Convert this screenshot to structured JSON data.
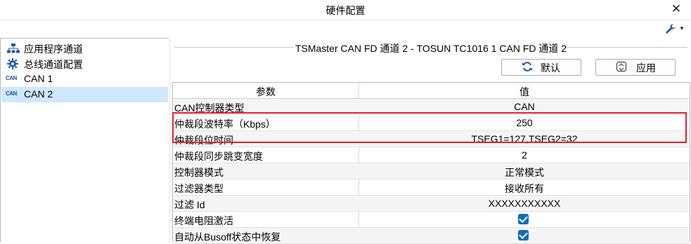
{
  "window": {
    "title": "硬件配置",
    "close_symbol": "✕"
  },
  "toolbar": {
    "tools_icon": "wrench-icon",
    "dropdown_icon": "caret-down-icon"
  },
  "sidebar": {
    "items": [
      {
        "label": "应用程序通道",
        "icon": "network-icon"
      },
      {
        "label": "总线通道配置",
        "icon": "gear-icon"
      },
      {
        "label": "CAN 1",
        "icon": "can-icon",
        "icon_text": "CAN"
      },
      {
        "label": "CAN 2",
        "icon": "can-icon",
        "icon_text": "CAN",
        "selected": true
      }
    ]
  },
  "panel": {
    "title": "TSMaster CAN FD 通道 2 - TOSUN TC1016 1 CAN FD 通道 2",
    "default_button": "默认",
    "apply_button": "应用",
    "headers": {
      "param": "参数",
      "value": "值"
    },
    "rows": [
      {
        "key": "CAN控制器类型",
        "value": "CAN"
      },
      {
        "key": "仲裁段波特率（Kbps）",
        "value": "250"
      },
      {
        "key": "仲裁段位时间",
        "value": "TSEG1=127,TSEG2=32"
      },
      {
        "key": "仲裁段同步跳变宽度",
        "value": "2"
      },
      {
        "key": "控制器模式",
        "value": "正常模式"
      },
      {
        "key": "过滤器类型",
        "value": "接收所有"
      },
      {
        "key": "过滤 Id",
        "value": "XXXXXXXXXXX"
      },
      {
        "key": "终端电阻激活",
        "checked": true
      },
      {
        "key": "自动从Busoff状态中恢复",
        "checked": true
      }
    ]
  },
  "colors": {
    "accent": "#0f6cbd",
    "selection": "#cde8ff",
    "highlight_box": "#e0232f"
  }
}
